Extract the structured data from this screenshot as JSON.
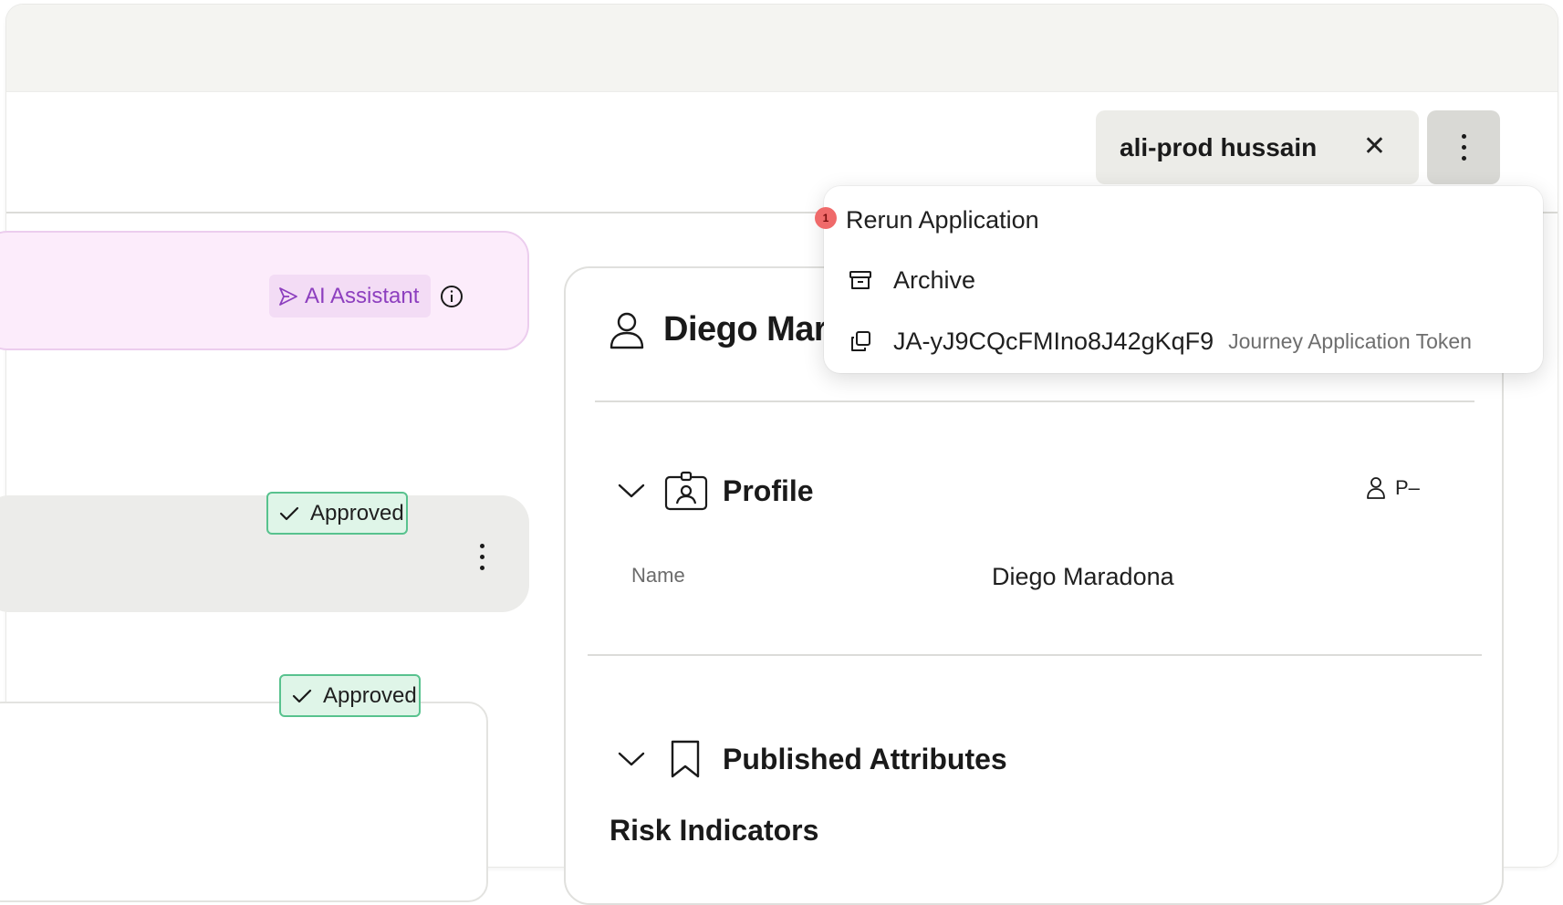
{
  "header": {
    "user_chip_label": "ali-prod hussain",
    "close_glyph": "✕"
  },
  "ai_assistant": {
    "label": "AI Assistant",
    "icon": "ai-send-icon",
    "accent_color": "#8d3fbf"
  },
  "status_rows": [
    {
      "badge": "Approved"
    },
    {
      "badge": "Approved"
    }
  ],
  "detail": {
    "person_name": "Diego Maradona",
    "person_name_visible": "Diego Mar",
    "profile": {
      "title": "Profile",
      "meta": "P–",
      "fields": [
        {
          "label": "Name",
          "value": "Diego Maradona"
        }
      ]
    },
    "published_attributes": {
      "title": "Published Attributes"
    },
    "risk_indicators": {
      "title": "Risk Indicators"
    }
  },
  "menu": {
    "notification_count": "1",
    "items": [
      {
        "label": "Rerun Application",
        "icon": "rerun-icon"
      },
      {
        "label": "Archive",
        "icon": "archive-icon"
      },
      {
        "label": "JA-yJ9CQcFMIno8J42gKqF9",
        "sub": "Journey Application Token",
        "icon": "copy-icon"
      }
    ]
  },
  "colors": {
    "approved_border": "#58c28e",
    "approved_bg": "#dff5e8",
    "notification": "#ef6a6a"
  }
}
